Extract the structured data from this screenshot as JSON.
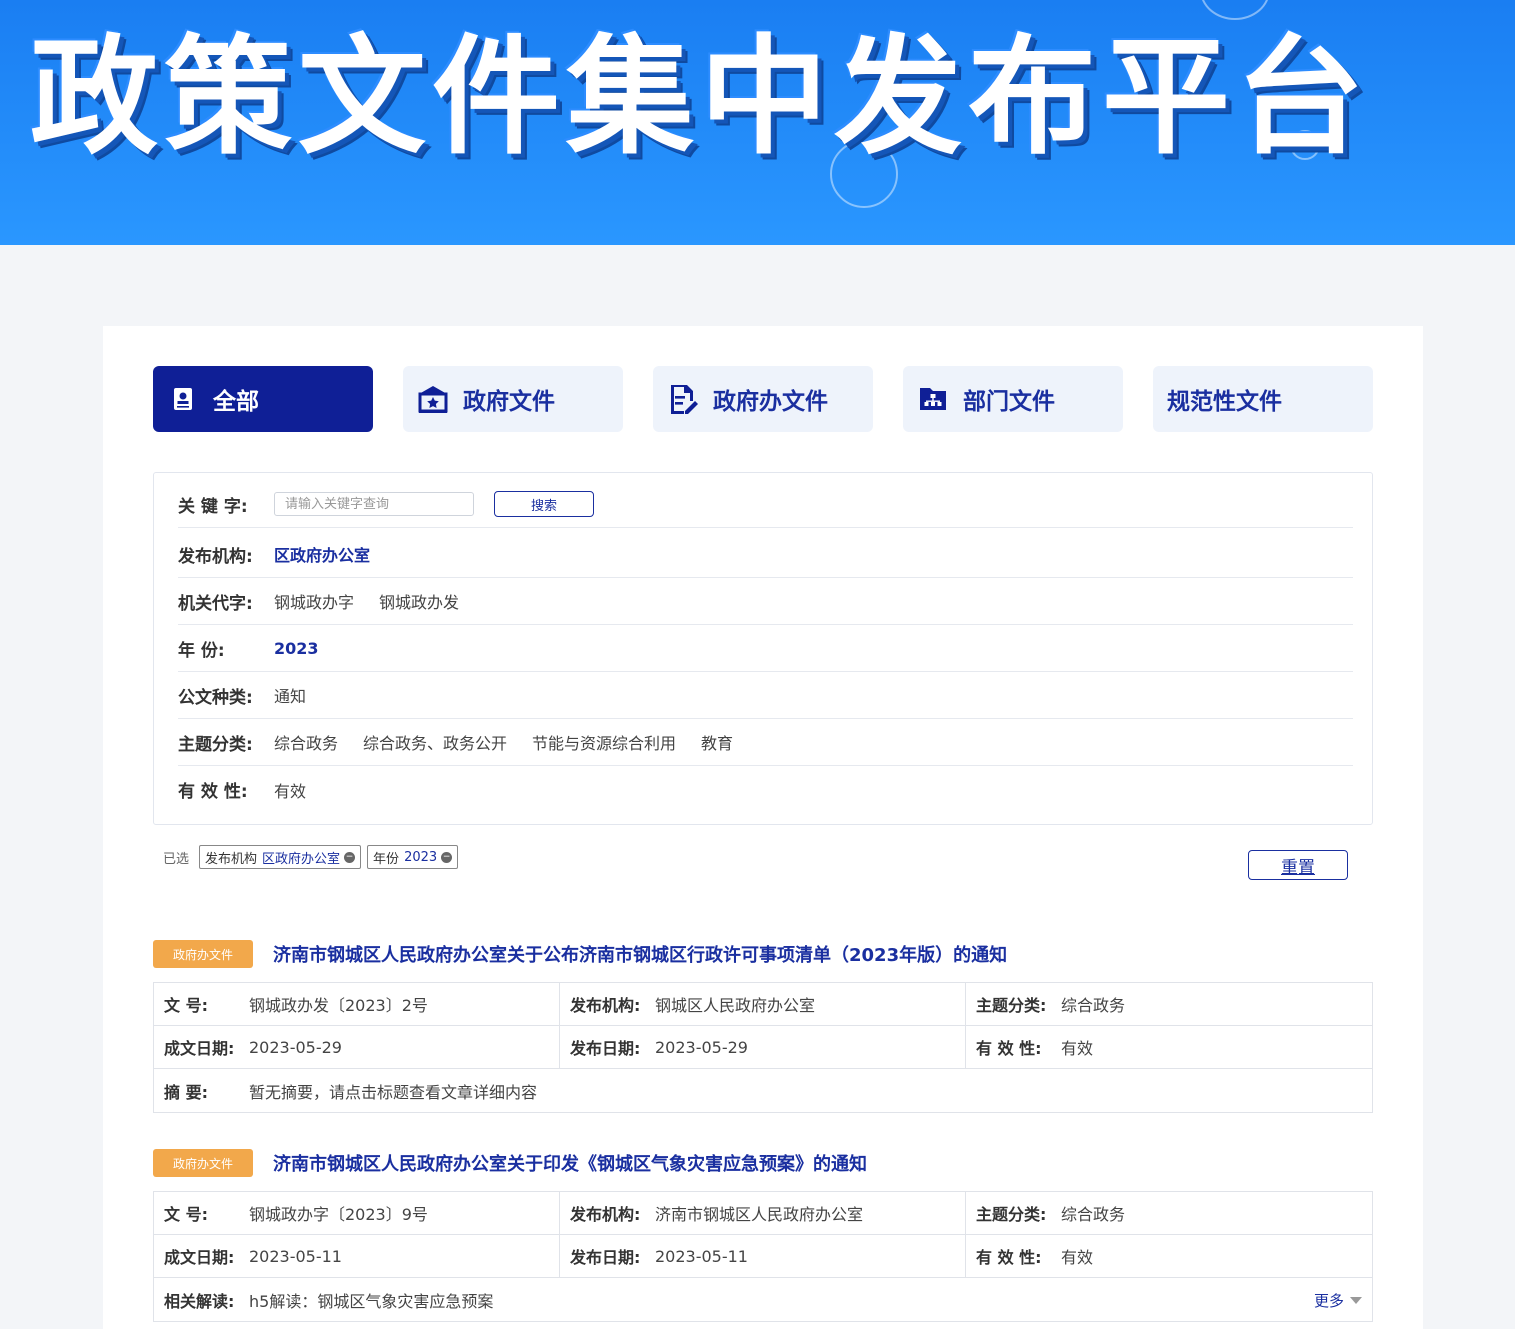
{
  "banner": {
    "title": "政策文件集中发布平台"
  },
  "tabs": [
    {
      "label": "全部",
      "icon": "contacts-book-icon",
      "active": true
    },
    {
      "label": "政府文件",
      "icon": "government-building-icon",
      "active": false
    },
    {
      "label": "政府办文件",
      "icon": "document-edit-icon",
      "active": false
    },
    {
      "label": "部门文件",
      "icon": "folder-org-icon",
      "active": false
    },
    {
      "label": "规范性文件",
      "icon": "",
      "active": false
    }
  ],
  "filters": {
    "keyword": {
      "label": "关 键 字:",
      "placeholder": "请输入关键字查询",
      "button": "搜索"
    },
    "org": {
      "label": "发布机构:",
      "options": [
        "区政府办公室"
      ]
    },
    "code": {
      "label": "机关代字:",
      "options": [
        "钢城政办字",
        "钢城政办发"
      ]
    },
    "year": {
      "label": "年 份:",
      "options": [
        "2023"
      ]
    },
    "type": {
      "label": "公文种类:",
      "options": [
        "通知"
      ]
    },
    "topic": {
      "label": "主题分类:",
      "options": [
        "综合政务",
        "综合政务、政务公开",
        "节能与资源综合利用",
        "教育"
      ]
    },
    "validity": {
      "label": "有 效 性:",
      "options": [
        "有效"
      ]
    }
  },
  "chosen": {
    "label": "已选",
    "chips": [
      {
        "key": "发布机构",
        "value": "区政府办公室"
      },
      {
        "key": "年份",
        "value": "2023"
      }
    ],
    "reset": "重置"
  },
  "docs": [
    {
      "tag": "政府办文件",
      "title": "济南市钢城区人民政府办公室关于公布济南市钢城区行政许可事项清单（2023年版）的通知",
      "labels": {
        "num": "文 号:",
        "org": "发布机构:",
        "topic": "主题分类:",
        "written": "成文日期:",
        "published": "发布日期:",
        "validity": "有 效 性:",
        "extra": "摘 要:"
      },
      "num": "钢城政办发〔2023〕2号",
      "org": "钢城区人民政府办公室",
      "topic": "综合政务",
      "written": "2023-05-29",
      "published": "2023-05-29",
      "validity": "有效",
      "extra": "暂无摘要，请点击标题查看文章详细内容"
    },
    {
      "tag": "政府办文件",
      "title": "济南市钢城区人民政府办公室关于印发《钢城区气象灾害应急预案》的通知",
      "labels": {
        "num": "文 号:",
        "org": "发布机构:",
        "topic": "主题分类:",
        "written": "成文日期:",
        "published": "发布日期:",
        "validity": "有 效 性:",
        "extra": "相关解读:"
      },
      "num": "钢城政办字〔2023〕9号",
      "org": "济南市钢城区人民政府办公室",
      "topic": "综合政务",
      "written": "2023-05-11",
      "published": "2023-05-11",
      "validity": "有效",
      "extra": "h5解读：钢城区气象灾害应急预案",
      "more": "更多"
    }
  ],
  "colors": {
    "primary": "#0f1f96",
    "link": "#1a2fa0",
    "tag": "#f2a84b",
    "banner": "#1a7ef2"
  }
}
